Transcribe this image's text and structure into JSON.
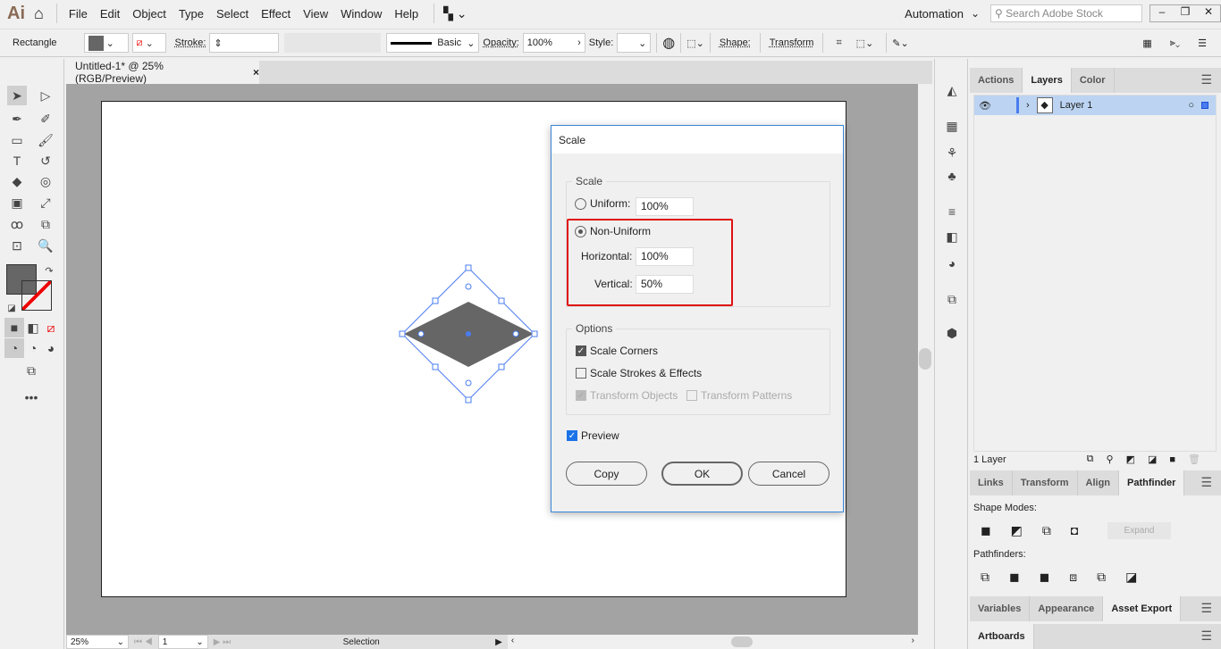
{
  "app": {
    "logo": "Ai",
    "menu": [
      "File",
      "Edit",
      "Object",
      "Type",
      "Select",
      "Effect",
      "View",
      "Window",
      "Help"
    ],
    "workspace": "Automation",
    "search_placeholder": "Search Adobe Stock"
  },
  "control": {
    "selection_type": "Rectangle",
    "stroke_label": "Stroke:",
    "brush": "Basic",
    "opacity_label": "Opacity:",
    "opacity": "100%",
    "style_label": "Style:",
    "shape_label": "Shape:",
    "transform_label": "Transform"
  },
  "document": {
    "tab_title": "Untitled-1* @ 25% (RGB/Preview)",
    "close": "×"
  },
  "dialog": {
    "title": "Scale",
    "scale_group": "Scale",
    "uniform_label": "Uniform:",
    "uniform_value": "100%",
    "uniform_selected": false,
    "nonuniform_label": "Non-Uniform",
    "nonuniform_selected": true,
    "horizontal_label": "Horizontal:",
    "horizontal_value": "100%",
    "vertical_label": "Vertical:",
    "vertical_value": "50%",
    "options_group": "Options",
    "scale_corners": "Scale Corners",
    "scale_corners_checked": true,
    "scale_strokes": "Scale Strokes & Effects",
    "scale_strokes_checked": false,
    "transform_objects": "Transform Objects",
    "transform_objects_checked": true,
    "transform_patterns": "Transform Patterns",
    "transform_patterns_checked": false,
    "preview": "Preview",
    "preview_checked": true,
    "copy": "Copy",
    "ok": "OK",
    "cancel": "Cancel",
    "highlight_color": "#e01010"
  },
  "layers_panel": {
    "tabs": [
      "Actions",
      "Layers",
      "Color"
    ],
    "active": "Layers",
    "layers": [
      {
        "name": "Layer 1"
      }
    ],
    "count": "1 Layer"
  },
  "pathfinder_panel": {
    "tabs": [
      "Links",
      "Transform",
      "Align",
      "Pathfinder"
    ],
    "active": "Pathfinder",
    "shape_modes": "Shape Modes:",
    "expand": "Expand",
    "pathfinders": "Pathfinders:"
  },
  "bottom_panel": {
    "tabs": [
      "Variables",
      "Appearance",
      "Asset Export"
    ],
    "active": "Asset Export"
  },
  "artboards_panel": {
    "tabs": [
      "Artboards"
    ]
  },
  "status": {
    "zoom": "25%",
    "artboard": "1",
    "tool": "Selection"
  },
  "colors": {
    "fill": "#666666",
    "selection": "#4a7cf0",
    "accent": "#1a73e8"
  }
}
